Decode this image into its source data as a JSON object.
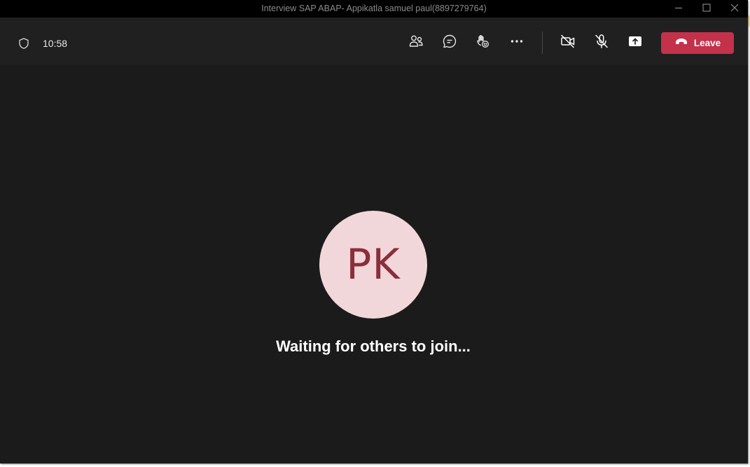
{
  "window": {
    "title": "Interview SAP ABAP- Appikatla samuel paul(8897279764)",
    "minimize_icon": "minimize-icon",
    "maximize_icon": "maximize-icon",
    "close_icon": "close-icon"
  },
  "toolbar": {
    "security_icon": "shield-icon",
    "timer": "10:58",
    "buttons": [
      {
        "name": "participants",
        "icon": "people-icon"
      },
      {
        "name": "chat",
        "icon": "chat-icon"
      },
      {
        "name": "reactions",
        "icon": "raise-hand-icon"
      },
      {
        "name": "more-actions",
        "icon": "more-icon"
      },
      {
        "name": "camera",
        "icon": "camera-off-icon"
      },
      {
        "name": "mic",
        "icon": "mic-off-icon"
      },
      {
        "name": "share",
        "icon": "share-screen-icon"
      }
    ],
    "leave_label": "Leave",
    "leave_icon": "phone-hangup-icon"
  },
  "stage": {
    "avatar_initials": "PK",
    "status_text": "Waiting for others to join..."
  },
  "colors": {
    "title_bar": "#000000",
    "toolbar": "#202020",
    "stage": "#1b1b1b",
    "leave": "#c4314b",
    "avatar_bg": "#f2d7da",
    "avatar_text": "#8b2e3b"
  }
}
